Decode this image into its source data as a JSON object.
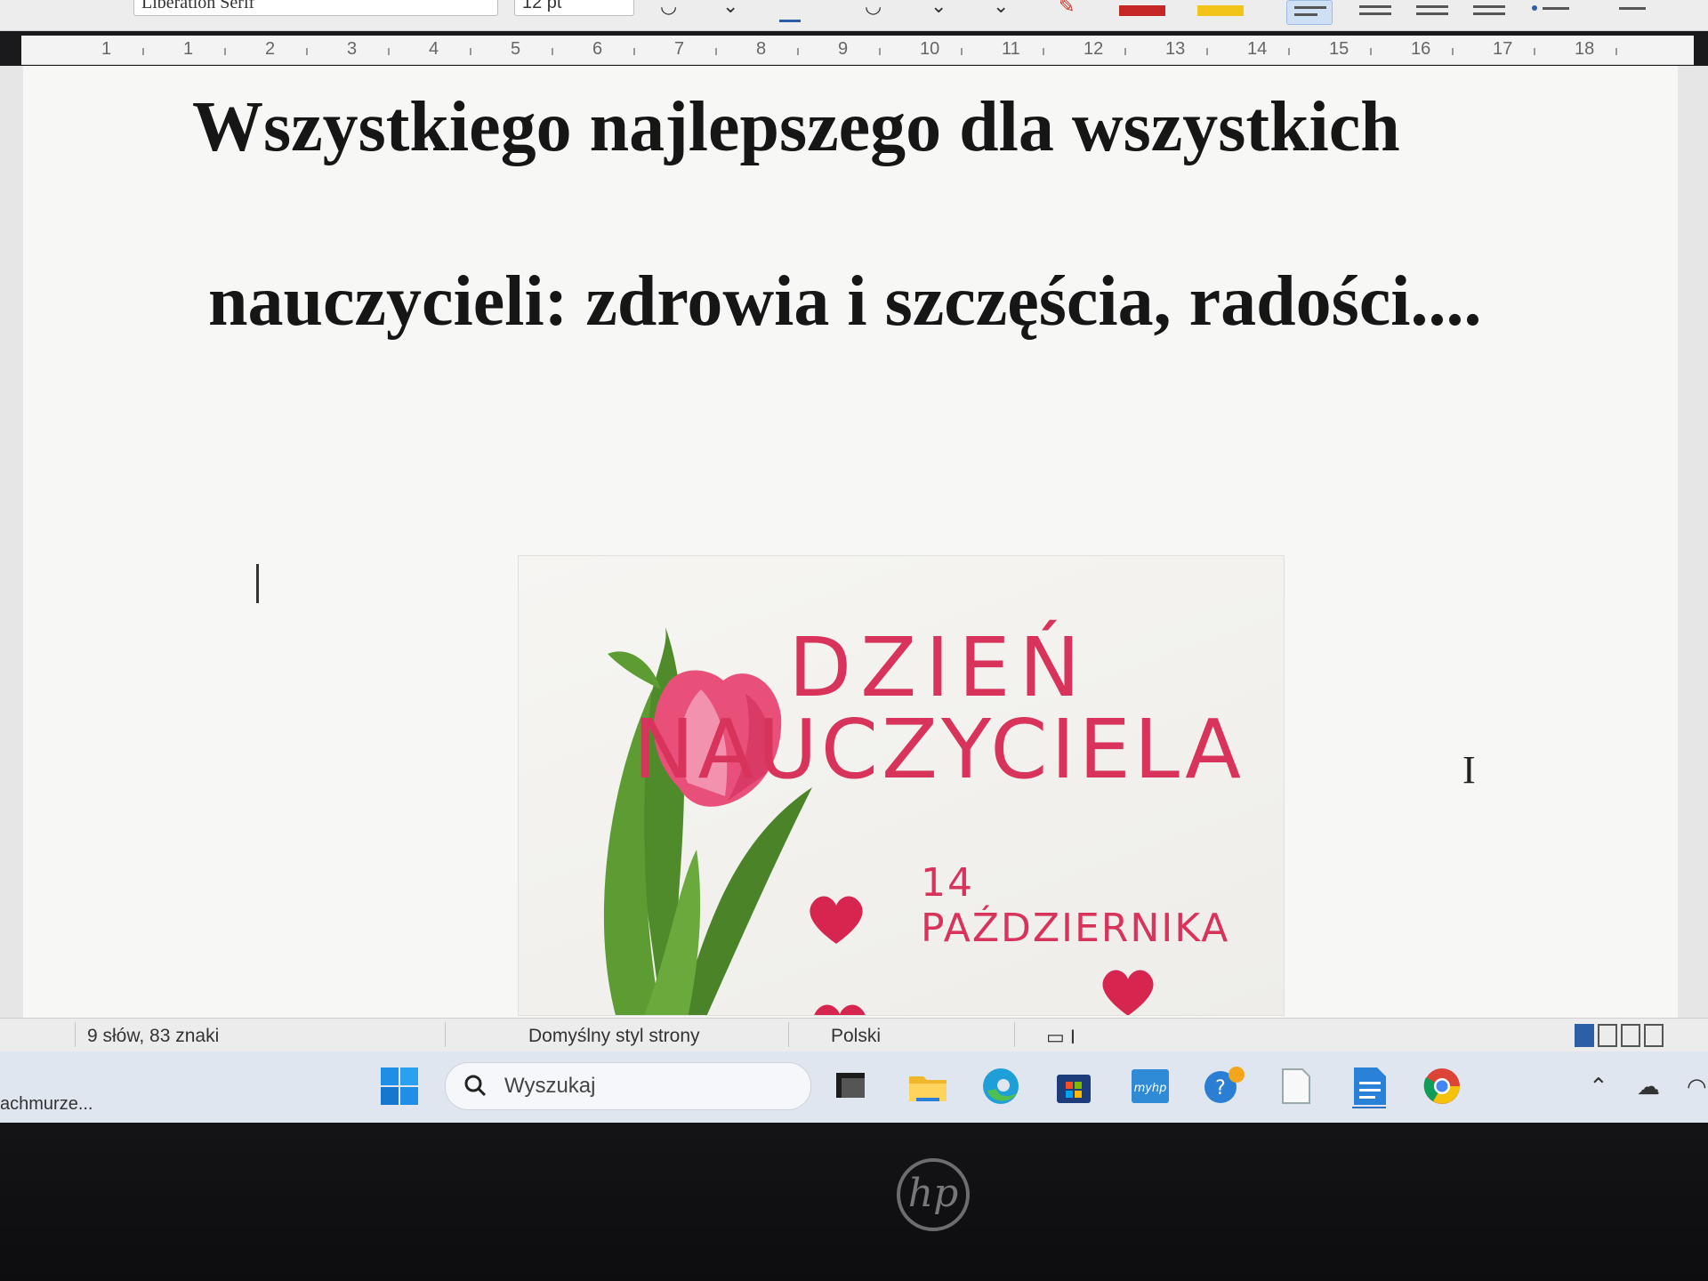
{
  "toolbar": {
    "font_name": "Liberation Serif",
    "font_size": "12 pt"
  },
  "ruler": {
    "numbers": [
      "1",
      "1",
      "2",
      "3",
      "4",
      "5",
      "6",
      "7",
      "8",
      "9",
      "10",
      "11",
      "12",
      "13",
      "14",
      "15",
      "16",
      "17",
      "18"
    ]
  },
  "document": {
    "line1": "Wszystkiego najlepszego dla wszystkich",
    "line2": "nauczycieli: zdrowia i szczęścia,  radości....",
    "card": {
      "title_line1": "DZIEŃ",
      "title_line2": "NAUCZYCIELA",
      "date": "14 PAŹDZIERNIKA",
      "accent_color": "#d8345b"
    }
  },
  "statusbar": {
    "word_count": "9 słów, 83 znaki",
    "page_style": "Domyślny styl strony",
    "language": "Polski"
  },
  "taskbar": {
    "cloud_status": "achmurze...",
    "search_placeholder": "Wyszukaj",
    "apps": [
      "windows-start-icon",
      "task-view-icon",
      "file-explorer-icon",
      "edge-icon",
      "microsoft-store-icon",
      "myhp-icon",
      "tips-icon",
      "notepad-icon",
      "libreoffice-writer-icon",
      "chrome-icon"
    ]
  },
  "bezel": {
    "logo": "hp"
  }
}
